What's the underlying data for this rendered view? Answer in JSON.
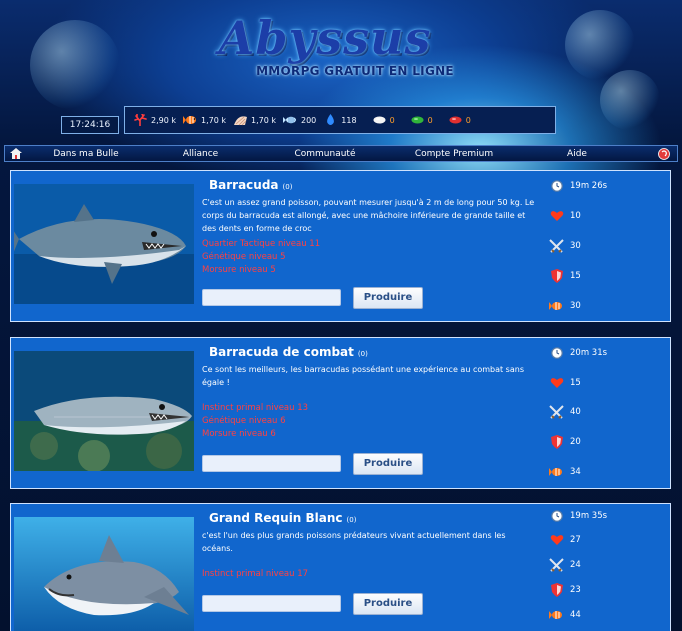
{
  "header": {
    "logo": "Abyssus",
    "subtitle": "MMORPG GRATUIT EN LIGNE",
    "clock": "17:24:16"
  },
  "resources": [
    {
      "icon": "coral-icon",
      "value": "2,90 k"
    },
    {
      "icon": "fish-icon",
      "value": "1,70 k"
    },
    {
      "icon": "shell-icon",
      "value": "1,70 k"
    },
    {
      "icon": "school-of-fish-icon",
      "value": "200"
    },
    {
      "icon": "water-drop-icon",
      "value": "118"
    },
    {
      "icon": "white-pearl-icon",
      "value": "0"
    },
    {
      "icon": "green-pearl-icon",
      "value": "0"
    },
    {
      "icon": "red-pearl-icon",
      "value": "0"
    }
  ],
  "nav": {
    "items": [
      "Dans ma Bulle",
      "Alliance",
      "Communauté",
      "Compte Premium",
      "Aide"
    ]
  },
  "units": [
    {
      "name": "Barracuda",
      "count": "(0)",
      "description": "C'est un assez grand poisson, pouvant mesurer jusqu'à 2 m de long pour 50 kg. Le corps du barracuda est allongé, avec une mâchoire inférieure de grande taille et des dents en forme de croc",
      "requirements": [
        "Quartier Tactique niveau 11",
        "Génétique niveau 5",
        "Morsure niveau 5"
      ],
      "button": "Produire",
      "time": "19m 26s",
      "life": "10",
      "attack": "30",
      "defense": "15",
      "cost": "30"
    },
    {
      "name": "Barracuda de combat",
      "count": "(0)",
      "description": "Ce sont les meilleurs, les barracudas possédant une expérience au combat sans égale !",
      "requirements": [
        "Instinct primal niveau 13",
        "Génétique niveau 6",
        "Morsure niveau 6"
      ],
      "button": "Produire",
      "time": "20m 31s",
      "life": "15",
      "attack": "40",
      "defense": "20",
      "cost": "34"
    },
    {
      "name": "Grand Requin Blanc",
      "count": "(0)",
      "description": "c'est l'un des plus grands poissons prédateurs vivant actuellement dans les océans.",
      "requirements": [
        "Instinct primal niveau 17"
      ],
      "button": "Produire",
      "time": "19m 35s",
      "life": "27",
      "attack": "24",
      "defense": "23",
      "cost": "44"
    }
  ],
  "colors": {
    "card_bg": "#1166cd",
    "requirement": "#ff4141",
    "resource_orange": "#ff9d2a"
  }
}
